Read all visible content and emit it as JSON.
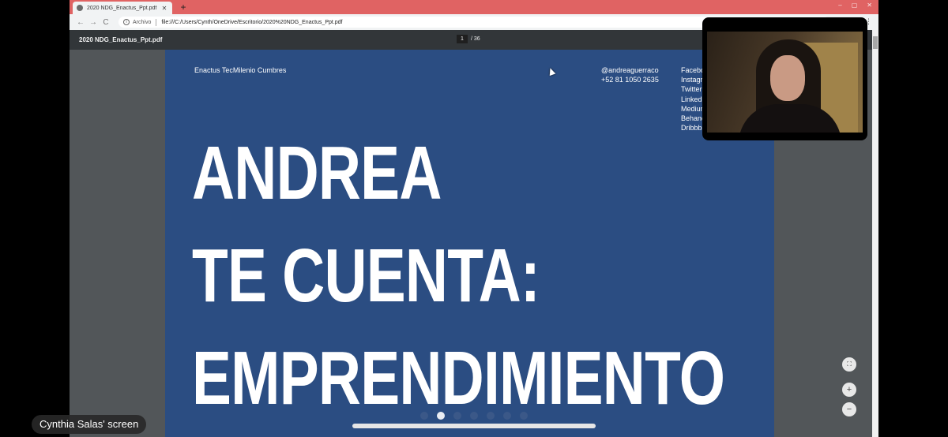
{
  "browser": {
    "tab_title": "2020 NDG_Enactus_Ppt.pdf",
    "tab_close": "✕",
    "new_tab": "+",
    "back": "←",
    "forward": "→",
    "reload": "C",
    "address_label": "Archivo",
    "url": "file:///C:/Users/Cynth/OneDrive/Escritorio/2020%20NDG_Enactus_Ppt.pdf",
    "window_controls": [
      "–",
      "▢",
      "✕"
    ],
    "menu": "⋮"
  },
  "pdf_viewer": {
    "title": "2020 NDG_Enactus_Ppt.pdf",
    "current_page": "1",
    "total_pages": "/ 36",
    "fit_icon": "⛶",
    "zoom_in": "+",
    "zoom_out": "−"
  },
  "slide": {
    "org": "Enactus TecMilenio Cumbres",
    "handle": "@andreaguerraco",
    "phone": "+52 81 1050 2635",
    "social": [
      "Facebo",
      "Instagr",
      "Twitter",
      "LinkedI",
      "Medium",
      "Behanc",
      "Dribbb"
    ],
    "headline": [
      "ANDREA",
      "TE CUENTA:",
      "EMPRENDIMIENTO"
    ]
  },
  "call": {
    "screen_label": "Cynthia Salas' screen",
    "pages": 7,
    "active_page": 1
  },
  "colors": {
    "tab_strip": "#e06363",
    "slide_bg": "#2b4d82"
  }
}
